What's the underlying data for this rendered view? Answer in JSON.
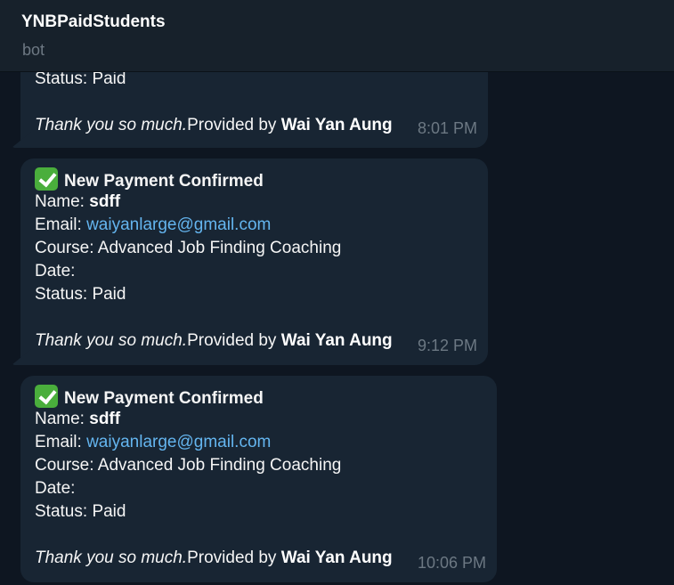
{
  "header": {
    "title": "YNBPaidStudents",
    "subtitle": "bot"
  },
  "messages": [
    {
      "status_label": "Status:",
      "status_value": "Paid",
      "thanks": "Thank you so much.",
      "provided_by": "Provided by",
      "author": "Wai Yan Aung",
      "time": "8:01 PM"
    },
    {
      "heading": "New Payment Confirmed",
      "name_label": "Name:",
      "name_value": "sdff",
      "email_label": "Email:",
      "email_value": "waiyanlarge@gmail.com",
      "course_label": "Course:",
      "course_value": "Advanced Job Finding Coaching",
      "date_label": "Date:",
      "status_label": "Status:",
      "status_value": "Paid",
      "thanks": "Thank you so much.",
      "provided_by": "Provided by",
      "author": "Wai Yan Aung",
      "time": "9:12 PM"
    },
    {
      "heading": "New Payment Confirmed",
      "name_label": "Name:",
      "name_value": "sdff",
      "email_label": "Email:",
      "email_value": "waiyanlarge@gmail.com",
      "course_label": "Course:",
      "course_value": "Advanced Job Finding Coaching",
      "date_label": "Date:",
      "status_label": "Status:",
      "status_value": "Paid",
      "thanks": "Thank you so much.",
      "provided_by": "Provided by",
      "author": "Wai Yan Aung",
      "time": "10:06 PM"
    }
  ],
  "icons": {
    "check": "check-mark-icon"
  },
  "colors": {
    "background": "#0e1621",
    "header": "#17212b",
    "bubble": "#182533",
    "link": "#64b5ef",
    "timestamp": "#6c7883",
    "check": "#4aae3c"
  }
}
